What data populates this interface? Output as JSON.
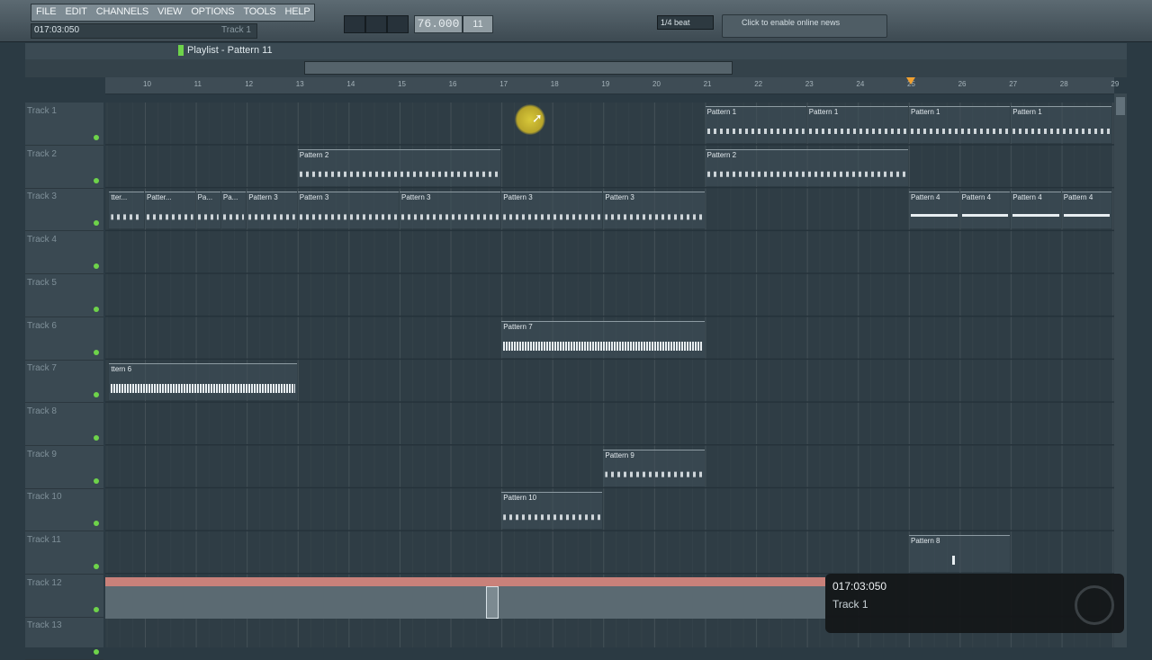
{
  "menu": [
    "FILE",
    "EDIT",
    "CHANNELS",
    "VIEW",
    "OPTIONS",
    "TOOLS",
    "HELP"
  ],
  "hint": {
    "time": "017:03:050",
    "track": "Track 1"
  },
  "transport": {
    "tempo": "76.000",
    "pattern": "11",
    "snap": "1/4 beat"
  },
  "news": "Click to enable online news",
  "playlist": {
    "title": "Playlist - Pattern 11"
  },
  "ruler": [
    "10",
    "11",
    "12",
    "13",
    "14",
    "15",
    "16",
    "17",
    "18",
    "19",
    "20",
    "21",
    "22",
    "23",
    "24",
    "25",
    "26",
    "27",
    "28",
    "29"
  ],
  "tracks": [
    "Track 1",
    "Track 2",
    "Track 3",
    "Track 4",
    "Track 5",
    "Track 6",
    "Track 7",
    "Track 8",
    "Track 9",
    "Track 10",
    "Track 11",
    "Track 12",
    "Track 13"
  ],
  "clips": [
    {
      "track": 1,
      "bar": 21,
      "len": 2,
      "label": "Pattern 1",
      "kind": "notes"
    },
    {
      "track": 1,
      "bar": 23,
      "len": 2,
      "label": "Pattern 1",
      "kind": "notes"
    },
    {
      "track": 1,
      "bar": 25,
      "len": 2,
      "label": "Pattern 1",
      "kind": "notes"
    },
    {
      "track": 1,
      "bar": 27,
      "len": 2,
      "label": "Pattern 1",
      "kind": "notes"
    },
    {
      "track": 2,
      "bar": 13,
      "len": 4,
      "label": "Pattern 2",
      "kind": "notes"
    },
    {
      "track": 2,
      "bar": 21,
      "len": 4,
      "label": "Pattern 2",
      "kind": "notes"
    },
    {
      "track": 3,
      "bar": 9.3,
      "len": 0.7,
      "label": "tter...",
      "kind": "notes"
    },
    {
      "track": 3,
      "bar": 10,
      "len": 1,
      "label": "Patter...",
      "kind": "notes"
    },
    {
      "track": 3,
      "bar": 11,
      "len": 0.5,
      "label": "Pa...",
      "kind": "notes"
    },
    {
      "track": 3,
      "bar": 11.5,
      "len": 0.5,
      "label": "Pa...",
      "kind": "notes"
    },
    {
      "track": 3,
      "bar": 12,
      "len": 1,
      "label": "Pattern 3",
      "kind": "notes"
    },
    {
      "track": 3,
      "bar": 13,
      "len": 2,
      "label": "Pattern 3",
      "kind": "notes"
    },
    {
      "track": 3,
      "bar": 15,
      "len": 2,
      "label": "Pattern 3",
      "kind": "notes"
    },
    {
      "track": 3,
      "bar": 17,
      "len": 2,
      "label": "Pattern 3",
      "kind": "notes"
    },
    {
      "track": 3,
      "bar": 19,
      "len": 2,
      "label": "Pattern 3",
      "kind": "notes"
    },
    {
      "track": 3,
      "bar": 25,
      "len": 1,
      "label": "Pattern 4",
      "kind": "line"
    },
    {
      "track": 3,
      "bar": 26,
      "len": 1,
      "label": "Pattern 4",
      "kind": "line"
    },
    {
      "track": 3,
      "bar": 27,
      "len": 1,
      "label": "Pattern 4",
      "kind": "line"
    },
    {
      "track": 3,
      "bar": 28,
      "len": 1,
      "label": "Pattern 4",
      "kind": "line"
    },
    {
      "track": 6,
      "bar": 17,
      "len": 4,
      "label": "Pattern 7",
      "kind": "wave"
    },
    {
      "track": 7,
      "bar": 9.3,
      "len": 3.7,
      "label": "ttern 6",
      "kind": "wave"
    },
    {
      "track": 9,
      "bar": 19,
      "len": 2,
      "label": "Pattern 9",
      "kind": "notes"
    },
    {
      "track": 10,
      "bar": 17,
      "len": 2,
      "label": "Pattern 10",
      "kind": "notes"
    },
    {
      "track": 11,
      "bar": 25,
      "len": 2,
      "label": "Pattern 8",
      "kind": "sparse"
    }
  ],
  "tooltip": {
    "time": "017:03:050",
    "track": "Track 1"
  }
}
